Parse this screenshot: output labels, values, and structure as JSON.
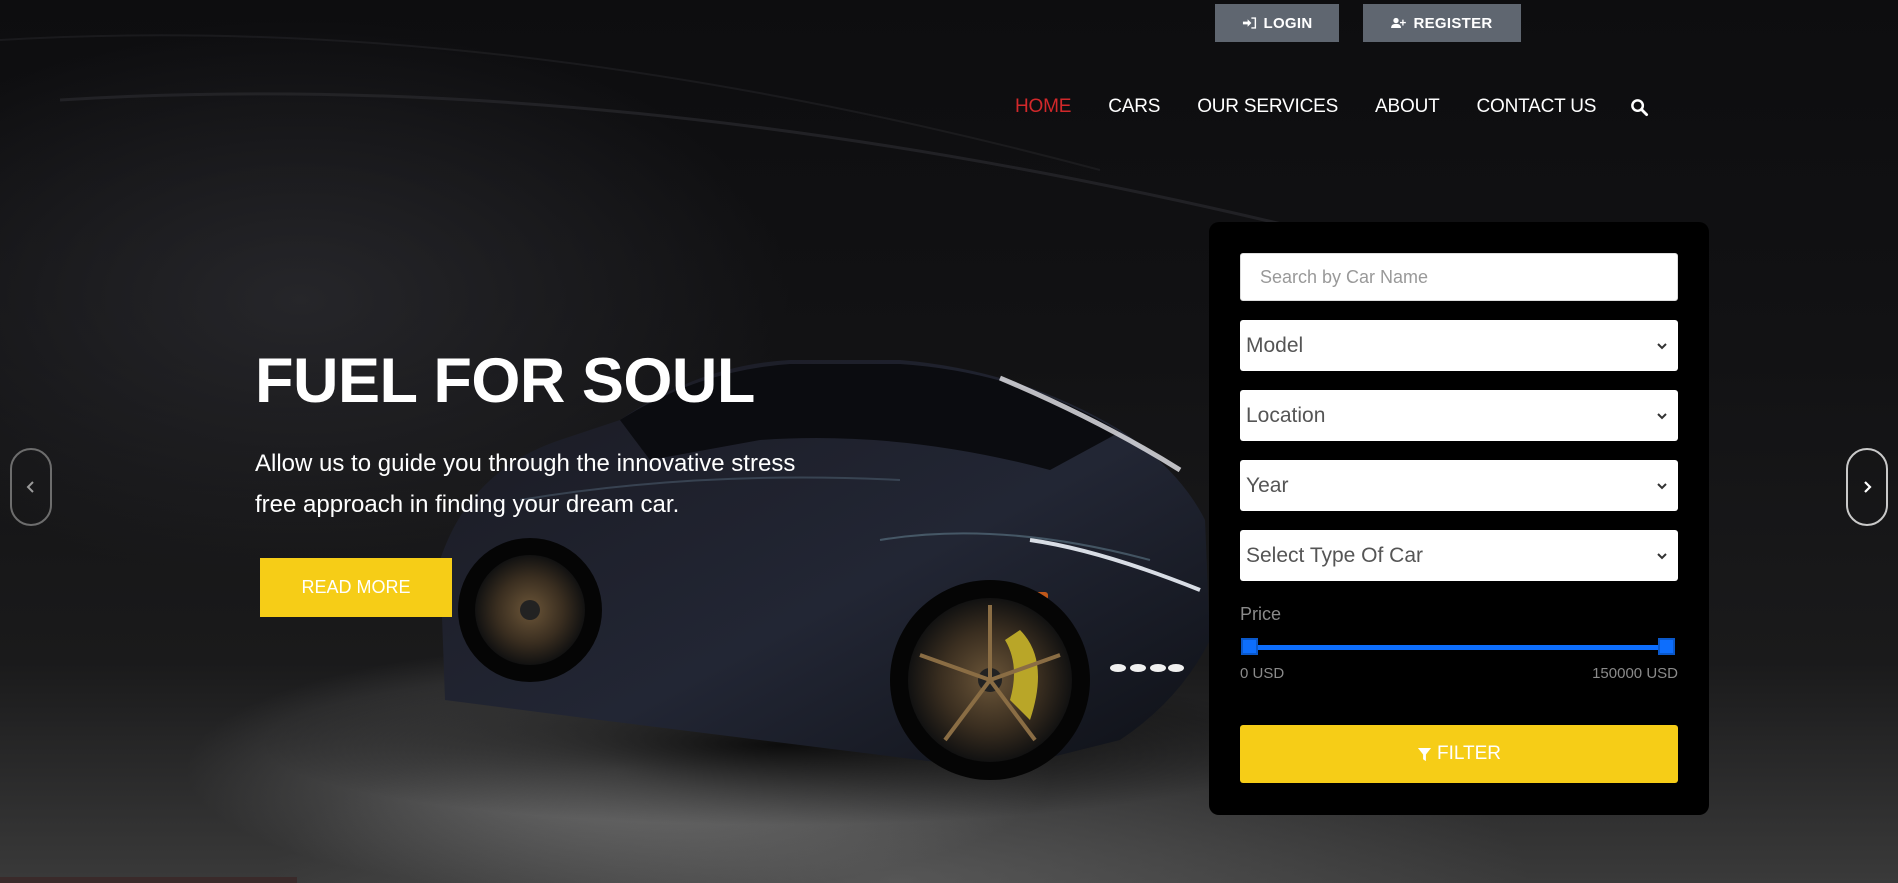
{
  "auth": {
    "login_label": "LOGIN",
    "login_icon": "sign-in-icon",
    "register_label": "REGISTER",
    "register_icon": "user-plus-icon"
  },
  "nav": {
    "items": [
      {
        "label": "HOME",
        "active": true
      },
      {
        "label": "CARS",
        "active": false
      },
      {
        "label": "OUR SERVICES",
        "active": false
      },
      {
        "label": "ABOUT",
        "active": false
      },
      {
        "label": "CONTACT US",
        "active": false
      }
    ],
    "search_icon": "search-icon",
    "active_color": "#d2282a"
  },
  "hero": {
    "title": "FUEL FOR SOUL",
    "description": "Allow us to guide you through the innovative stress free approach in finding your dream car.",
    "cta_label": "READ MORE",
    "cta_color": "#f6cd17"
  },
  "search_panel": {
    "search_placeholder": "Search by Car Name",
    "selects": [
      {
        "name": "model",
        "selected": "Model"
      },
      {
        "name": "location",
        "selected": "Location"
      },
      {
        "name": "year",
        "selected": "Year"
      },
      {
        "name": "car-type",
        "selected": "Select Type Of Car"
      }
    ],
    "price": {
      "label": "Price",
      "min_label": "0 USD",
      "max_label": "150000 USD",
      "min_value": 0,
      "max_value": 150000,
      "slider_color": "#0d6efd"
    },
    "filter_label": "FILTER",
    "filter_icon": "filter-icon"
  }
}
